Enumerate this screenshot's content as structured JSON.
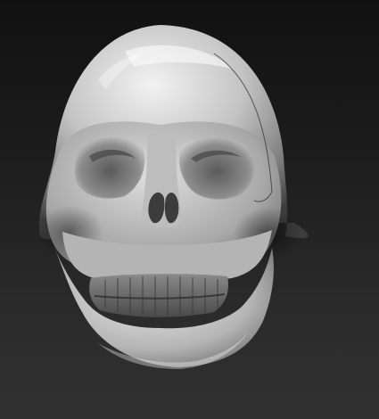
{
  "scene": {
    "subject": "skull-sculpt",
    "background_top": "#111111",
    "background_bottom": "#313131",
    "material_light": "#e6e6e6",
    "material_mid": "#9a9a9a",
    "material_dark": "#3a3a3a"
  }
}
